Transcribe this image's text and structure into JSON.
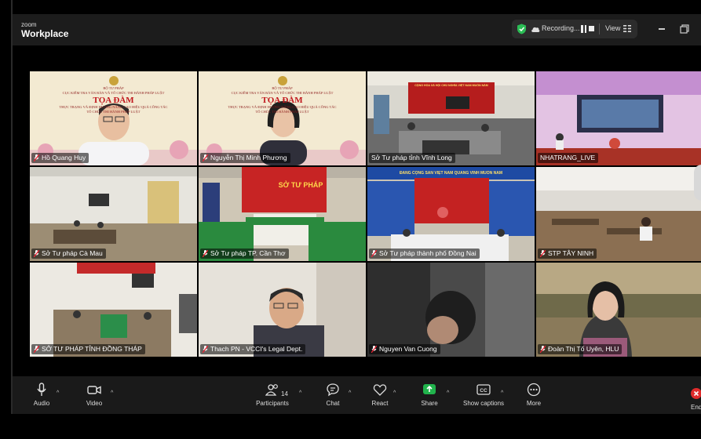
{
  "app": {
    "brand_small": "zoom",
    "brand_name": "Workplace"
  },
  "status_bar": {
    "recording_label": "Recording...",
    "view_label": "View"
  },
  "participants_grid": [
    {
      "name": "Hồ Quang Huy",
      "mic": "muted",
      "scene": "banner"
    },
    {
      "name": "Nguyễn Thị Minh Phương",
      "mic": "muted",
      "scene": "banner"
    },
    {
      "name": "Sở Tư pháp tỉnh Vĩnh Long",
      "mic": "none",
      "scene": "hall"
    },
    {
      "name": "NHATRANG_LIVE",
      "mic": "none",
      "scene": "pink",
      "speaking": true
    },
    {
      "name": "Sở Tư pháp Cà Mau",
      "mic": "muted",
      "scene": "room"
    },
    {
      "name": "Sở Tư pháp TP. Cần Thơ",
      "mic": "muted",
      "scene": "green"
    },
    {
      "name": "Sở Tư pháp thành phố Đồng Nai",
      "mic": "muted",
      "scene": "red"
    },
    {
      "name": "STP TÂY NINH",
      "mic": "muted",
      "scene": "class"
    },
    {
      "name": "SỞ TƯ PHÁP TỈNH ĐỒNG THÁP",
      "mic": "muted",
      "scene": "office"
    },
    {
      "name": "Thach PN - VCCI's Legal Dept.",
      "mic": "muted",
      "scene": "person"
    },
    {
      "name": "Nguyen Van Cuong",
      "mic": "muted",
      "scene": "dark"
    },
    {
      "name": "Đoàn Thị Tố Uyên, HLU",
      "mic": "muted",
      "scene": "woman"
    }
  ],
  "banner_text": {
    "line1": "BỘ TƯ PHÁP",
    "line2": "CỤC KIỂM TRA VĂN BẢN VÀ TỔ CHỨC THI HÀNH PHÁP LUẬT",
    "line3": "TỌA ĐÀM",
    "line4": "THỰC TRẠNG VÀ ĐỊNH HƯỚNG NÂNG CAO HIỆU QUẢ CÔNG TÁC",
    "line5": "TỔ CHỨC THI HÀNH PHÁP LUẬT"
  },
  "scene_signs": {
    "hall": "CỘNG HÒA XÃ HỘI CHỦ NGHĨA VIỆT NAM MUÔN NĂM",
    "green": "SỞ TƯ PHÁP",
    "red": "ĐẢNG CỘNG SẢN VIỆT NAM QUANG VINH MUÔN NĂM"
  },
  "toolbar": {
    "audio": "Audio",
    "video": "Video",
    "participants": "Participants",
    "participants_count": "14",
    "chat": "Chat",
    "react": "React",
    "share": "Share",
    "captions": "Show captions",
    "more": "More",
    "end": "End"
  },
  "colors": {
    "speaker_highlight": "#3ed46b",
    "share_green": "#21b34c",
    "end_red": "#e02b2b",
    "shield_green": "#2bbd55"
  }
}
